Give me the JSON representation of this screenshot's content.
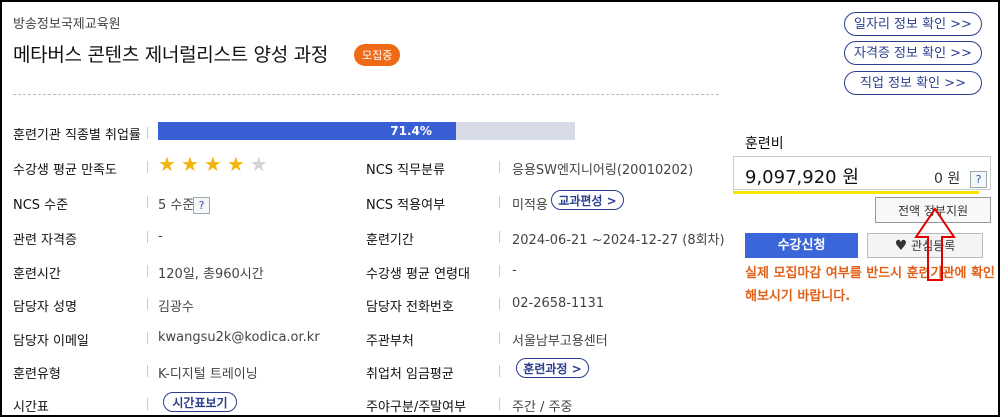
{
  "header": {
    "org": "방송정보국제교육원",
    "title": "메타버스 콘텐츠 제너럴리스트 양성 과정",
    "badge": "모집중"
  },
  "top_buttons": {
    "job_info": "일자리 정보 확인 >>",
    "cert_info": "자격증 정보 확인 >>",
    "occupation_info": "직업 정보 확인 >>"
  },
  "details": {
    "employment_rate_label": "훈련기관 직종별 취업률",
    "employment_rate_value": "71.4%",
    "employment_rate_fraction": 0.714,
    "satisfaction_label": "수강생 평균 만족도",
    "satisfaction_stars": 4,
    "satisfaction_max": 5,
    "ncs_class_label": "NCS 직무분류",
    "ncs_class_value": "응용SW엔지니어링(20010202)",
    "ncs_level_label": "NCS 수준",
    "ncs_level_value": "5 수준",
    "ncs_apply_label": "NCS 적용여부",
    "ncs_apply_value": "미적용",
    "curriculum_button": "교과편성 >",
    "related_cert_label": "관련 자격증",
    "related_cert_value": "-",
    "period_label": "훈련기간",
    "period_value": "2024-06-21 ~2024-12-27 (8회차)",
    "hours_label": "훈련시간",
    "hours_value": "120일, 총960시간",
    "avg_age_label": "수강생 평균 연령대",
    "avg_age_value": "-",
    "manager_label": "담당자 성명",
    "manager_value": "김광수",
    "phone_label": "담당자 전화번호",
    "phone_value": "02-2658-1131",
    "email_label": "담당자 이메일",
    "email_value": "kwangsu2k@kodica.or.kr",
    "dept_label": "주관부처",
    "dept_value": "서울남부고용센터",
    "type_label": "훈련유형",
    "type_value": "K-디지털 트레이닝",
    "wage_label": "취업처 임금평균",
    "wage_button": "훈련과정 >",
    "schedule_label": "시간표",
    "schedule_button": "시간표보기",
    "daynight_label": "주야구분/주말여부",
    "daynight_value": "주간 / 주중"
  },
  "sidebar": {
    "fee_title": "훈련비",
    "fee_amount": "9,097,920 원",
    "fee_self": "0 원",
    "help_mark": "?",
    "support_button": "전액 정부지원",
    "apply_button": "수강신청",
    "favorite_button": "관심등록",
    "notice": "실제 모집마감 여부를 반드시 훈련기관에 확인해보시기 바랍니다."
  },
  "colors": {
    "accent": "#3a66d9",
    "badge": "#ee6a16",
    "notice": "#e2611a",
    "highlight": "#f6e500",
    "annotation": "#e00000"
  }
}
